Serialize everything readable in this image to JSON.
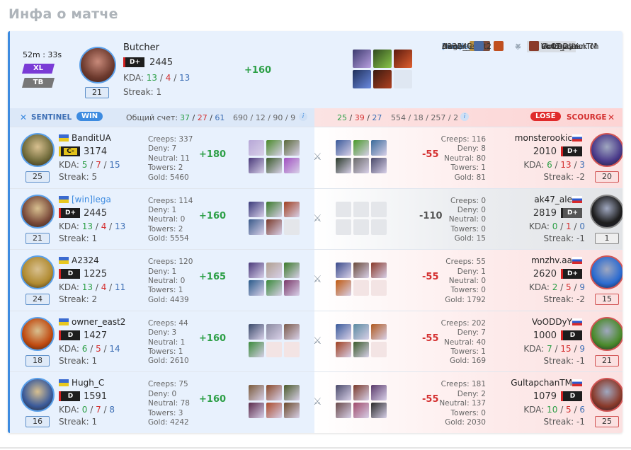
{
  "page_title": "Инфа о матче",
  "summary": {
    "duration": "52m : 33s",
    "mode": "XL",
    "mode2": "TB",
    "player": {
      "name": "Butcher",
      "rank": "D+",
      "rating": "2445",
      "kda_label": "KDA:",
      "kills": "13",
      "deaths": "4",
      "assists": "13",
      "streak": "Streak: 1",
      "level": "21",
      "gain": "+160"
    },
    "sentinel_names": [
      "BanditUA",
      "[win]lega",
      "A2324",
      "owner_east2",
      "Hugh_C"
    ],
    "scourge_names": [
      "monsterookich",
      "ak47_ale",
      "mnzhv.aa",
      "VoODDyY",
      "GultapchanTM"
    ]
  },
  "teambar": {
    "sentinel_label": "SENTINEL",
    "win_label": "WIN",
    "score_label": "Общий счет:",
    "s_k": "37",
    "s_d": "27",
    "s_a": "61",
    "s_stats": "690 / 12 / 90 / 9",
    "sc_k": "25",
    "sc_d": "39",
    "sc_a": "27",
    "sc_stats": "554 / 18 / 257 / 2",
    "info_icon": "i",
    "lose_label": "LOSE",
    "scourge_label": "SCOURGE"
  },
  "rows": [
    {
      "l": {
        "name": "BanditUA",
        "rank": "C-",
        "rating": "3174",
        "k": "5",
        "d": "7",
        "a": "15",
        "streak": "Streak: 5",
        "level": "25",
        "creeps": "Creeps: 337",
        "deny": "Deny: 7",
        "neutral": "Neutral: 11",
        "towers": "Towers: 2",
        "gold": "Gold: 5460",
        "gain": "+180"
      },
      "r": {
        "name": "monsterookic",
        "rank": "D+",
        "rating": "2010",
        "k": "6",
        "d": "13",
        "a": "3",
        "streak": "Streak: -2",
        "level": "20",
        "creeps": "Creeps: 116",
        "deny": "Deny: 8",
        "neutral": "Neutral: 80",
        "towers": "Towers: 1",
        "gold": "Gold: 81",
        "gain": "-55"
      }
    },
    {
      "l": {
        "name": "[win]lega",
        "rank": "D+",
        "rating": "2445",
        "k": "13",
        "d": "4",
        "a": "13",
        "streak": "Streak: 1",
        "level": "21",
        "creeps": "Creeps: 114",
        "deny": "Deny: 1",
        "neutral": "Neutral: 0",
        "towers": "Towers: 2",
        "gold": "Gold: 5554",
        "gain": "+160"
      },
      "r": {
        "name": "ak47_ale",
        "rank": "D+",
        "rating": "2819",
        "k": "0",
        "d": "1",
        "a": "0",
        "streak": "Streak: -1",
        "level": "1",
        "creeps": "Creeps: 0",
        "deny": "Deny: 0",
        "neutral": "Neutral: 0",
        "towers": "Towers: 0",
        "gold": "Gold: 15",
        "gain": "-110"
      }
    },
    {
      "l": {
        "name": "A2324",
        "rank": "D",
        "rating": "1225",
        "k": "13",
        "d": "4",
        "a": "11",
        "streak": "Streak: 2",
        "level": "24",
        "creeps": "Creeps: 120",
        "deny": "Deny: 1",
        "neutral": "Neutral: 0",
        "towers": "Towers: 1",
        "gold": "Gold: 4439",
        "gain": "+165"
      },
      "r": {
        "name": "mnzhv.aa",
        "rank": "D+",
        "rating": "2620",
        "k": "2",
        "d": "5",
        "a": "9",
        "streak": "Streak: -2",
        "level": "15",
        "creeps": "Creeps: 55",
        "deny": "Deny: 1",
        "neutral": "Neutral: 0",
        "towers": "Towers: 0",
        "gold": "Gold: 1792",
        "gain": "-55"
      }
    },
    {
      "l": {
        "name": "owner_east2",
        "rank": "D",
        "rating": "1427",
        "k": "6",
        "d": "5",
        "a": "14",
        "streak": "Streak: 1",
        "level": "18",
        "creeps": "Creeps: 44",
        "deny": "Deny: 3",
        "neutral": "Neutral: 1",
        "towers": "Towers: 1",
        "gold": "Gold: 2610",
        "gain": "+160"
      },
      "r": {
        "name": "VoODDyY",
        "rank": "D",
        "rating": "1000",
        "k": "7",
        "d": "15",
        "a": "9",
        "streak": "Streak: -1",
        "level": "21",
        "creeps": "Creeps: 202",
        "deny": "Deny: 7",
        "neutral": "Neutral: 40",
        "towers": "Towers: 1",
        "gold": "Gold: 169",
        "gain": "-55"
      }
    },
    {
      "l": {
        "name": "Hugh_C",
        "rank": "D",
        "rating": "1591",
        "k": "0",
        "d": "7",
        "a": "8",
        "streak": "Streak: 1",
        "level": "16",
        "creeps": "Creeps: 75",
        "deny": "Deny: 0",
        "neutral": "Neutral: 78",
        "towers": "Towers: 3",
        "gold": "Gold: 4242",
        "gain": "+160"
      },
      "r": {
        "name": "GultapchanTM",
        "rank": "D",
        "rating": "1079",
        "k": "10",
        "d": "5",
        "a": "6",
        "streak": "Streak: -1",
        "level": "25",
        "creeps": "Creeps: 181",
        "deny": "Deny: 2",
        "neutral": "Neutral: 137",
        "towers": "Towers: 0",
        "gold": "Gold: 2030",
        "gain": "-55"
      }
    }
  ],
  "colors": {
    "accent": "#3d8be0",
    "win": "#2c9f46",
    "lose": "#d43030",
    "sentinel_bg": "#e8f1fd",
    "scourge_bg": "#fbe1e1"
  }
}
